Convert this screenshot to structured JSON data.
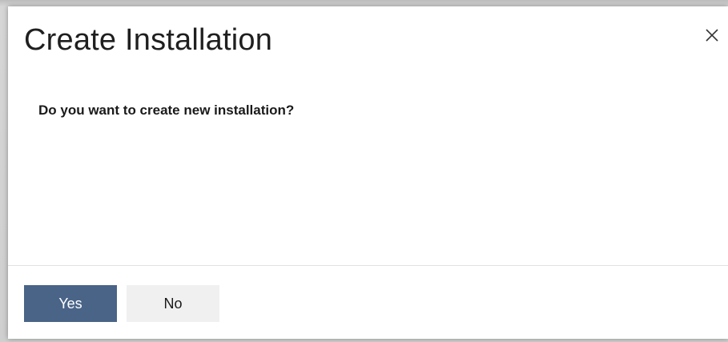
{
  "dialog": {
    "title": "Create Installation",
    "message": "Do you want to create new installation?",
    "close_icon": "close-icon"
  },
  "footer": {
    "yes_label": "Yes",
    "no_label": "No"
  },
  "colors": {
    "primary_button": "#4a6488",
    "secondary_button": "#f0f0f0",
    "backdrop": "#c9c9c9"
  }
}
